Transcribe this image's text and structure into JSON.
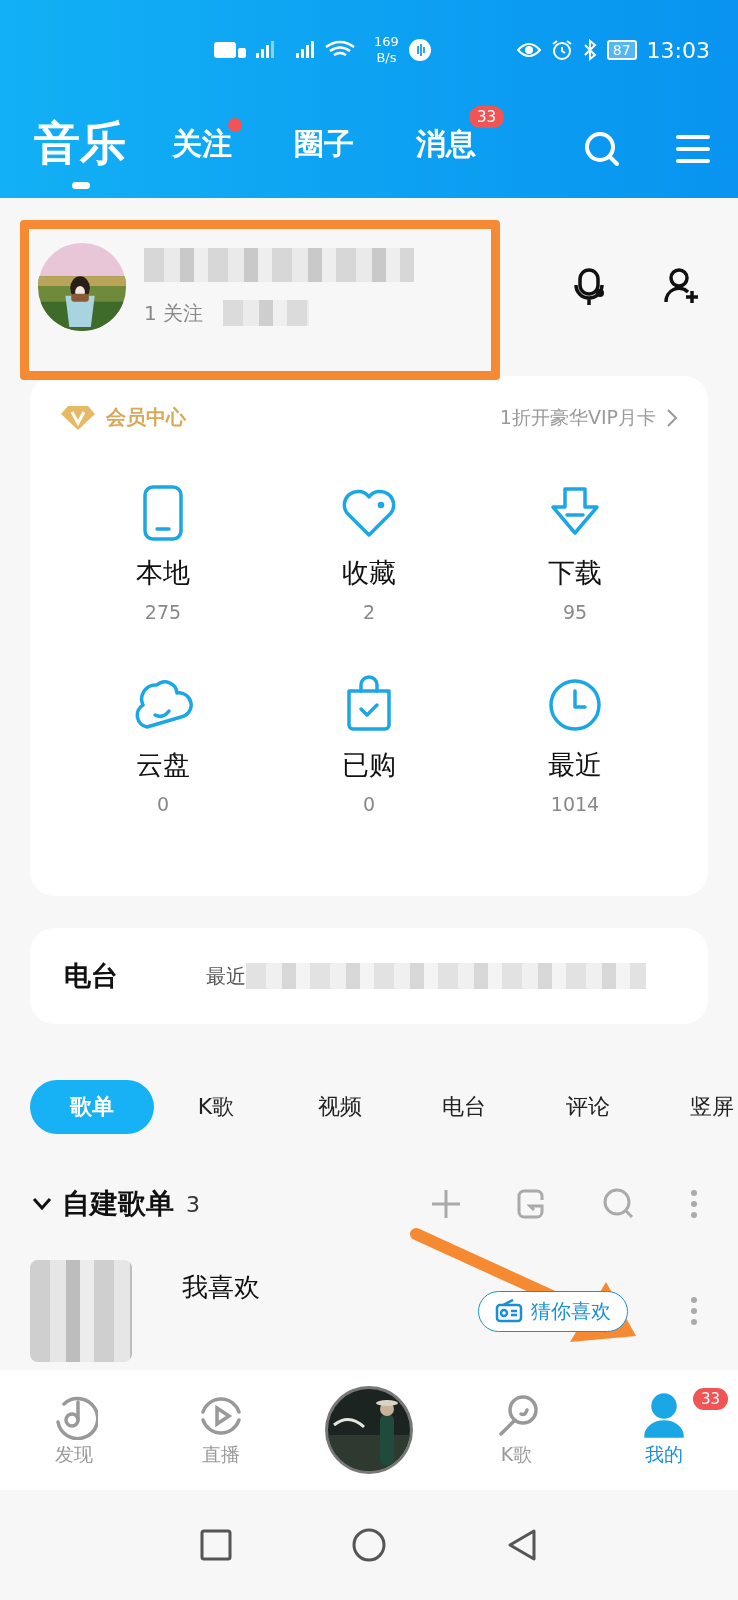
{
  "status_bar": {
    "speed": "169",
    "speed_unit": "B/s",
    "battery": "87",
    "time": "13:03"
  },
  "header": {
    "tabs": [
      {
        "label": "音乐",
        "selected": true,
        "dot": false
      },
      {
        "label": "关注",
        "selected": false,
        "dot": true
      },
      {
        "label": "圈子",
        "selected": false,
        "dot": false
      },
      {
        "label": "消息",
        "selected": false,
        "dot": false,
        "badge": "33"
      }
    ]
  },
  "profile": {
    "follow": "1 关注"
  },
  "vip": {
    "title": "会员中心",
    "offer": "1折开豪华VIP月卡"
  },
  "library": [
    {
      "label": "本地",
      "count": "275"
    },
    {
      "label": "收藏",
      "count": "2"
    },
    {
      "label": "下载",
      "count": "95"
    },
    {
      "label": "云盘",
      "count": "0"
    },
    {
      "label": "已购",
      "count": "0"
    },
    {
      "label": "最近",
      "count": "1014"
    }
  ],
  "radio": {
    "title": "电台",
    "recent": "最近"
  },
  "content_tabs": [
    {
      "label": "歌单",
      "selected": true
    },
    {
      "label": "K歌",
      "selected": false
    },
    {
      "label": "视频",
      "selected": false
    },
    {
      "label": "电台",
      "selected": false
    },
    {
      "label": "评论",
      "selected": false
    },
    {
      "label": "竖屏",
      "selected": false
    }
  ],
  "playlists_section": {
    "expanded": true,
    "title": "自建歌单",
    "count": "3"
  },
  "playlists": [
    {
      "name": "我喜欢",
      "action": "猜你喜欢"
    }
  ],
  "bottom_nav": [
    {
      "label": "发现",
      "selected": false,
      "kind": "tab"
    },
    {
      "label": "直播",
      "selected": false,
      "kind": "tab"
    },
    {
      "kind": "player"
    },
    {
      "label": "K歌",
      "selected": false,
      "kind": "tab"
    },
    {
      "label": "我的",
      "selected": true,
      "kind": "tab",
      "badge": "33"
    }
  ]
}
